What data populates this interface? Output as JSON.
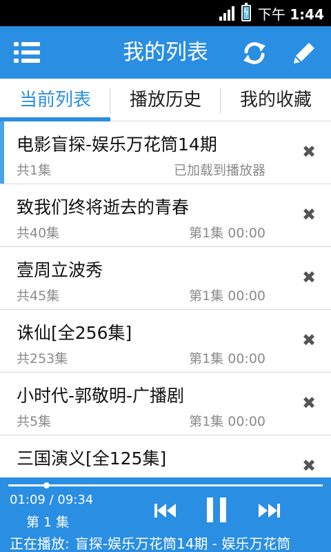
{
  "status_bar": {
    "time_prefix": "下午",
    "time": "1:44"
  },
  "header": {
    "title": "我的列表",
    "menu_icon": "menu-icon",
    "refresh_icon": "refresh-icon",
    "edit_icon": "edit-icon",
    "color": "#2a8ee2"
  },
  "tabs": [
    {
      "label": "当前列表",
      "active": true
    },
    {
      "label": "播放历史",
      "active": false
    },
    {
      "label": "我的收藏",
      "active": false
    }
  ],
  "list": [
    {
      "name": "电影盲探-娱乐万花筒14期",
      "count": "共1集",
      "status": "已加载到播放器",
      "selected": true
    },
    {
      "name": "致我们终将逝去的青春",
      "count": "共40集",
      "status": "第1集 00:00",
      "selected": false
    },
    {
      "name": "壹周立波秀",
      "count": "共45集",
      "status": "第1集 00:00",
      "selected": false
    },
    {
      "name": "诛仙[全256集]",
      "count": "共253集",
      "status": "第1集 00:00",
      "selected": false
    },
    {
      "name": "小时代-郭敬明-广播剧",
      "count": "共5集",
      "status": "第1集 00:00",
      "selected": false
    },
    {
      "name": "三国演义[全125集]",
      "count": "",
      "status": "",
      "selected": false
    }
  ],
  "close_symbol": "✖",
  "player": {
    "time": "01:09 / 09:34",
    "progress": 0.12,
    "episode": "第 1 集",
    "now_label": "正在播放:",
    "now_track": "盲探-娱乐万花筒14期 - 娱乐万花筒"
  }
}
